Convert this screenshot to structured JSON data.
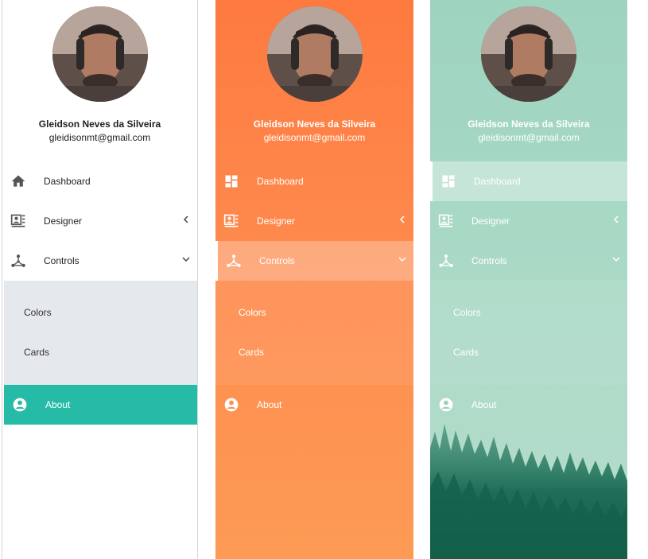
{
  "profile": {
    "name": "Gleidson Neves da Silveira",
    "email": "gleidisonmt@gmail.com"
  },
  "menu": {
    "dashboard": "Dashboard",
    "designer": "Designer",
    "controls": "Controls",
    "colors": "Colors",
    "cards": "Cards",
    "about": "About"
  },
  "icons": {
    "panel1_dashboard": "home-icon",
    "panel2_dashboard": "dashboard-grid-icon",
    "designer": "designer-icon",
    "controls": "controls-icon",
    "about": "account-circle-icon",
    "designer_chevron": "chevron-left-icon",
    "controls_chevron": "chevron-down-icon"
  },
  "colors": {
    "about_active_bg": "#26bba7",
    "submenu_bg": "#e5e8ec",
    "orange_top": "#fe7a3f",
    "orange_bottom": "#fd9b55",
    "mint_top": "#9dd3bf",
    "forest": "#1c6b55"
  }
}
